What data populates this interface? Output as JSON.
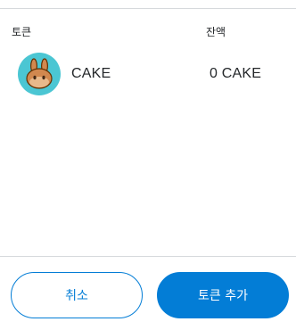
{
  "table": {
    "header_token": "토큰",
    "header_balance": "잔액",
    "rows": [
      {
        "icon": "pancakeswap-bunny-icon",
        "symbol": "CAKE",
        "balance": "0 CAKE"
      }
    ]
  },
  "actions": {
    "cancel_label": "취소",
    "add_label": "토큰 추가"
  },
  "colors": {
    "primary": "#037dd6",
    "text": "#24272a",
    "divider": "#d6d9dc",
    "icon_bg": "#4bc6d3",
    "icon_bunny": "#d1884f"
  }
}
